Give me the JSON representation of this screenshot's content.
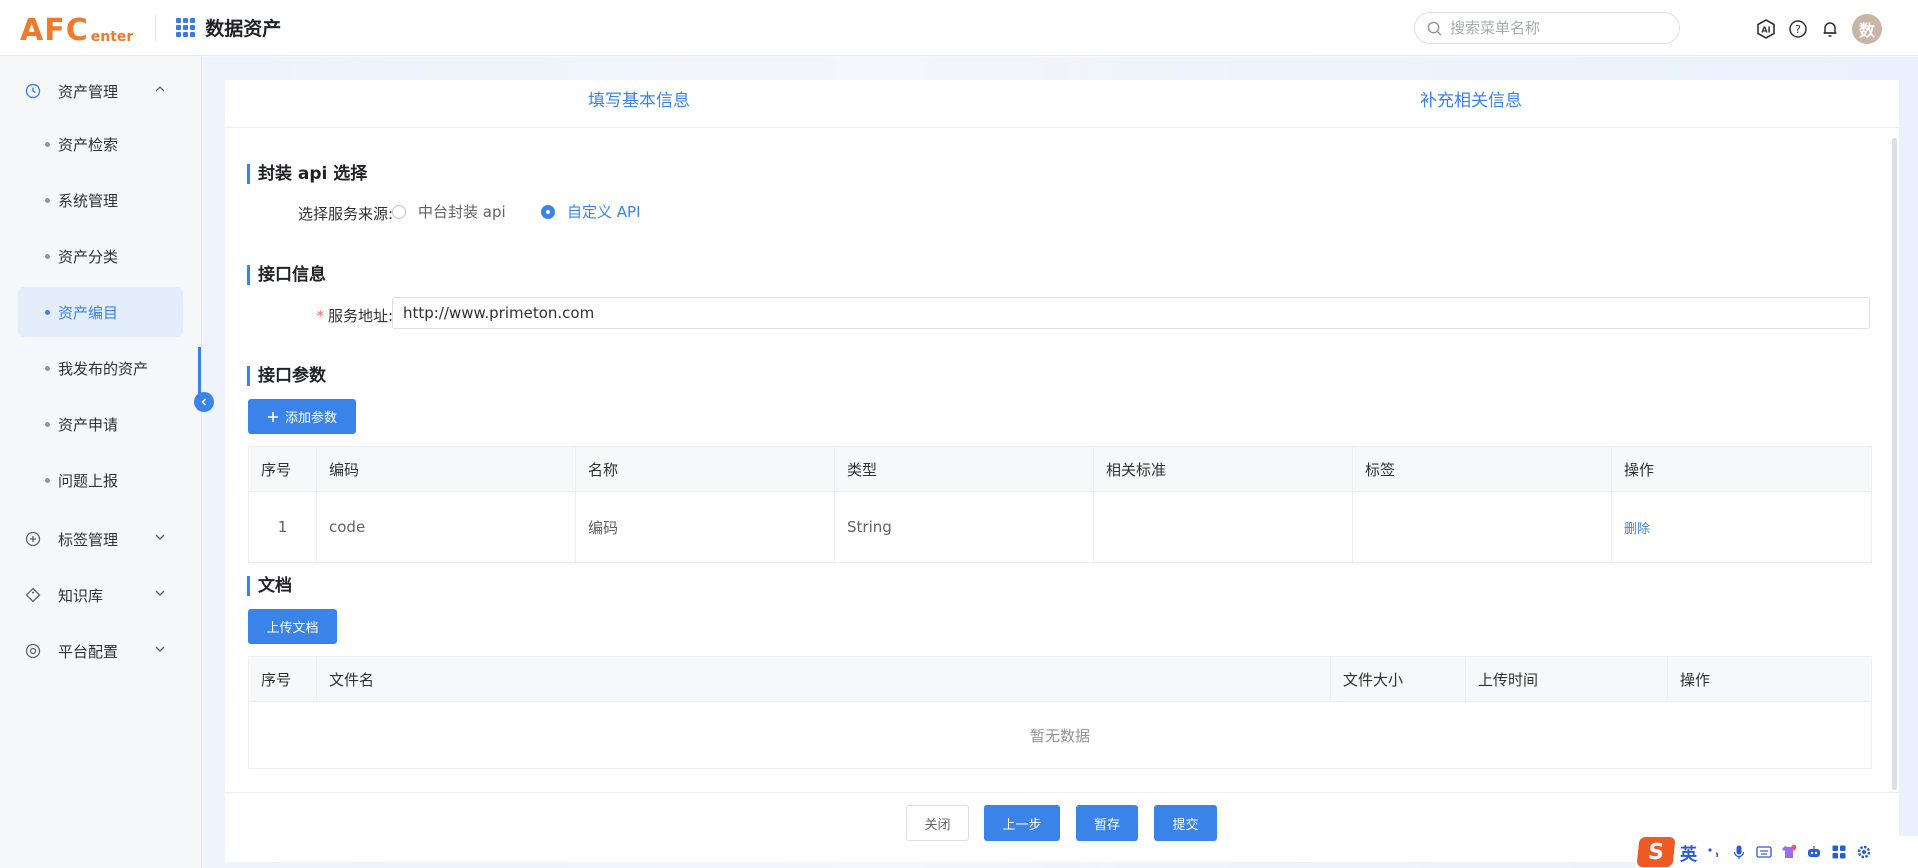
{
  "header": {
    "logo_main": "AFC",
    "logo_sub": "enter",
    "title": "数据资产",
    "search_placeholder": "搜索菜单名称",
    "avatar_text": "数",
    "accent": "#3a84e9"
  },
  "sidebar": {
    "groups": [
      {
        "label": "资产管理",
        "icon": "clock-icon",
        "expanded": true
      },
      {
        "label": "标签管理",
        "icon": "plus-circle-icon",
        "expanded": false
      },
      {
        "label": "知识库",
        "icon": "tag-icon",
        "expanded": false
      },
      {
        "label": "平台配置",
        "icon": "settings-icon",
        "expanded": false
      }
    ],
    "items": [
      {
        "label": "资产检索"
      },
      {
        "label": "系统管理"
      },
      {
        "label": "资产分类"
      },
      {
        "label": "资产编目",
        "active": true
      },
      {
        "label": "我发布的资产"
      },
      {
        "label": "资产申请"
      },
      {
        "label": "问题上报"
      }
    ]
  },
  "steps": [
    "填写基本信息",
    "补充相关信息"
  ],
  "api_section": {
    "title": "封装 api 选择",
    "label": "选择服务来源:",
    "options": [
      "中台封装 api",
      "自定义 API"
    ],
    "selected": "自定义 API"
  },
  "interface_section": {
    "title": "接口信息",
    "required_mark": "*",
    "address_label": "服务地址:",
    "address_value": "http://www.primeton.com"
  },
  "params_section": {
    "title": "接口参数",
    "add_button": "添加参数",
    "columns": [
      "序号",
      "编码",
      "名称",
      "类型",
      "相关标准",
      "标签",
      "操作"
    ],
    "rows": [
      {
        "index": "1",
        "code": "code",
        "name": "编码",
        "type": "String",
        "standard": "",
        "tag": "",
        "action": "删除"
      }
    ]
  },
  "docs_section": {
    "title": "文档",
    "upload_button": "上传文档",
    "columns": [
      "序号",
      "文件名",
      "文件大小",
      "上传时间",
      "操作"
    ],
    "empty_text": "暂无数据"
  },
  "footer": {
    "close": "关闭",
    "prev": "上一步",
    "save": "暂存",
    "submit": "提交"
  },
  "ime": {
    "logo": "S",
    "lang": "英"
  }
}
